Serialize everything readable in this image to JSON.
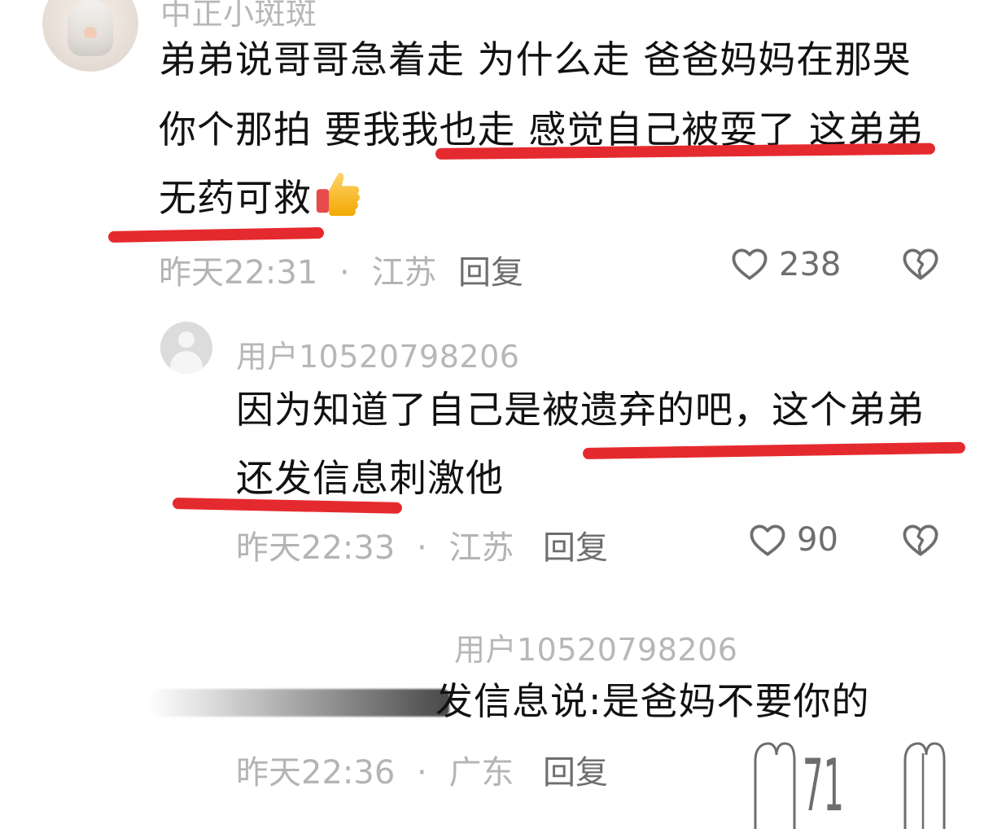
{
  "comments": [
    {
      "username": "中正小斑斑",
      "text_line1": "弟弟说哥哥急着走 为什么走 爸爸妈妈在那哭",
      "text_line2": "你个那拍 要我我也走 感觉自己被耍了 这弟弟",
      "text_line3": "无药可救",
      "time": "昨天22:31",
      "location": "江苏",
      "reply_label": "回复",
      "likes": "238"
    },
    {
      "username": "用户10520798206",
      "text_line1": "因为知道了自己是被遗弃的吧，这个弟弟",
      "text_line2": "还发信息刺激他",
      "time": "昨天22:33",
      "location": "江苏",
      "reply_label": "回复",
      "likes": "90"
    },
    {
      "username": "用户10520798206",
      "text_line1": "发信息说:是爸妈不要你的",
      "time": "昨天22:36",
      "location": "广东",
      "reply_label": "回复",
      "likes": "71"
    }
  ],
  "separator": "·",
  "icons": {
    "like": "heart-outline-icon",
    "dislike": "broken-heart-icon",
    "emoji": "thumbs-up-icon"
  },
  "colors": {
    "underline": "#e52a2f",
    "meta_text": "#b4b4b4",
    "username_text": "#b7b7b7",
    "comment_text": "#111111"
  }
}
